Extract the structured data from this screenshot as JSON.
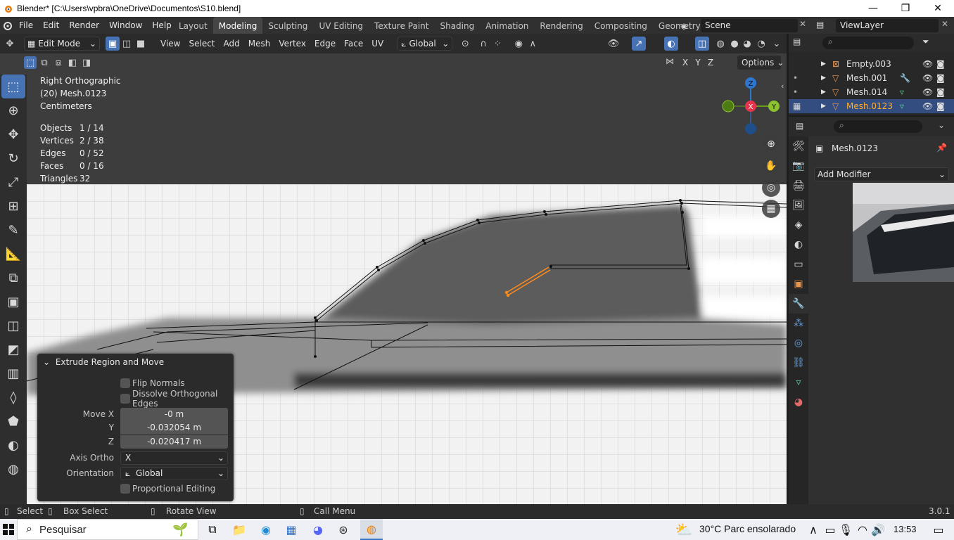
{
  "window": {
    "title": "Blender* [C:\\Users\\vpbra\\OneDrive\\Documentos\\S10.blend]",
    "minimize": "—",
    "maximize": "❐",
    "close": "✕"
  },
  "menu": [
    "File",
    "Edit",
    "Render",
    "Window",
    "Help"
  ],
  "workspaces": [
    "Layout",
    "Modeling",
    "Sculpting",
    "UV Editing",
    "Texture Paint",
    "Shading",
    "Animation",
    "Rendering",
    "Compositing",
    "Geometry Nod"
  ],
  "active_workspace": "Modeling",
  "scene": "Scene",
  "view_layer": "ViewLayer",
  "header": {
    "mode": "Edit Mode",
    "menus": [
      "View",
      "Select",
      "Add",
      "Mesh",
      "Vertex",
      "Edge",
      "Face",
      "UV"
    ],
    "orientation": "Global",
    "options": "Options",
    "axes": [
      "X",
      "Y",
      "Z"
    ]
  },
  "overlay": {
    "view": "Right Orthographic",
    "object": "(20) Mesh.0123",
    "units": "Centimeters"
  },
  "stats": [
    {
      "label": "Objects",
      "value": "1 / 14"
    },
    {
      "label": "Vertices",
      "value": "2 / 38"
    },
    {
      "label": "Edges",
      "value": "0 / 52"
    },
    {
      "label": "Faces",
      "value": "0 / 16"
    },
    {
      "label": "Triangles",
      "value": "32"
    }
  ],
  "gizmo": {
    "z": "Z",
    "y": "Y",
    "x": "X"
  },
  "operator": {
    "title": "Extrude Region and Move",
    "flip_normals": "Flip Normals",
    "dissolve": "Dissolve Orthogonal Edges",
    "move_x_label": "Move X",
    "move_x": "-0 m",
    "y_label": "Y",
    "move_y": "-0.032054 m",
    "z_label": "Z",
    "move_z": "-0.020417 m",
    "axis_ortho_label": "Axis Ortho",
    "axis_ortho": "X",
    "orientation_label": "Orientation",
    "orientation": "Global",
    "proportional": "Proportional Editing"
  },
  "outliner": {
    "items": [
      {
        "name": "Empty.003",
        "selected": false
      },
      {
        "name": "Mesh.001",
        "selected": false
      },
      {
        "name": "Mesh.014",
        "selected": false
      },
      {
        "name": "Mesh.0123",
        "selected": true
      }
    ]
  },
  "properties": {
    "object": "Mesh.0123",
    "add_modifier": "Add Modifier"
  },
  "statusbar": {
    "select": "Select",
    "box_select": "Box Select",
    "rotate_view": "Rotate View",
    "call_menu": "Call Menu",
    "version": "3.0.1"
  },
  "taskbar": {
    "search": "Pesquisar",
    "weather": "30°C  Parc ensolarado",
    "time": "13:53"
  },
  "colors": {
    "accent": "#4772b3",
    "selected_text": "#ffaf29",
    "selection_edge": "#ff8c1a"
  }
}
